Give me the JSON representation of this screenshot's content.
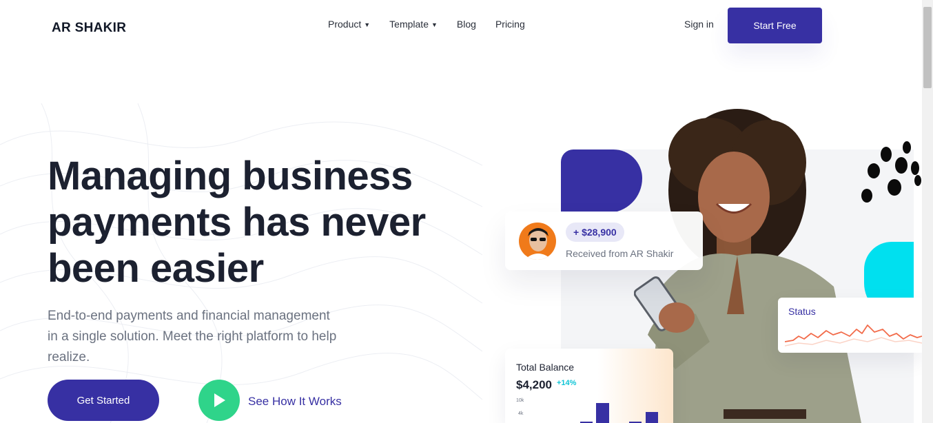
{
  "header": {
    "logo": "AR SHAKIR",
    "nav": [
      {
        "label": "Product",
        "has_dropdown": true
      },
      {
        "label": "Template",
        "has_dropdown": true
      },
      {
        "label": "Blog",
        "has_dropdown": false
      },
      {
        "label": "Pricing",
        "has_dropdown": false
      }
    ],
    "signin_label": "Sign in",
    "start_free_label": "Start Free"
  },
  "hero": {
    "headline_lines": [
      "Managing business",
      "payments has never",
      "been easier"
    ],
    "subtext_lines": [
      "End-to-end payments and financial management",
      "in a single solution. Meet the right platform to help",
      "realize."
    ],
    "get_started_label": "Get Started",
    "see_how_label": "See How It Works"
  },
  "cards": {
    "received": {
      "amount": "+ $28,900",
      "text": "Received from AR Shakir"
    },
    "status": {
      "label": "Status"
    },
    "balance": {
      "label": "Total Balance",
      "value": "$4,200",
      "change": "+14%",
      "axis_labels": [
        "10k",
        "4k"
      ]
    }
  },
  "colors": {
    "primary": "#3730a3",
    "play": "#2fd48a",
    "cyan": "#00e0ef",
    "status_line": "#f26b4a"
  },
  "icons": {
    "chevron": "chevron-down-icon",
    "play": "play-icon"
  }
}
